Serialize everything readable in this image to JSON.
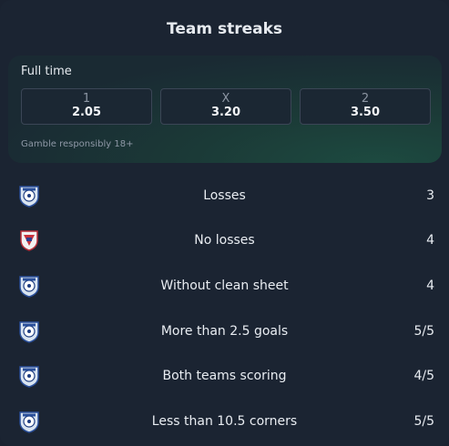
{
  "title": "Team streaks",
  "full_time": {
    "label": "Full time",
    "odds": [
      {
        "key": "1",
        "value": "2.05"
      },
      {
        "key": "X",
        "value": "3.20"
      },
      {
        "key": "2",
        "value": "3.50"
      }
    ],
    "disclaimer": "Gamble responsibly 18+"
  },
  "streaks": [
    {
      "team_icon": "team-a-crest-icon",
      "label": "Losses",
      "value": "3"
    },
    {
      "team_icon": "team-b-crest-icon",
      "label": "No losses",
      "value": "4"
    },
    {
      "team_icon": "team-a-crest-icon",
      "label": "Without clean sheet",
      "value": "4"
    },
    {
      "team_icon": "team-a-crest-icon",
      "label": "More than 2.5 goals",
      "value": "5/5"
    },
    {
      "team_icon": "team-a-crest-icon",
      "label": "Both teams scoring",
      "value": "4/5"
    },
    {
      "team_icon": "team-a-crest-icon",
      "label": "Less than 10.5 corners",
      "value": "5/5"
    }
  ],
  "colors": {
    "background": "#1b2432",
    "panel_accent": "#1d4a40"
  }
}
